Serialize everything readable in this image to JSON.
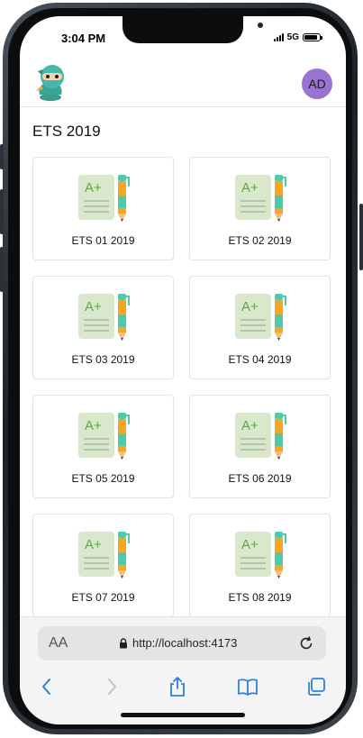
{
  "status": {
    "time": "3:04 PM",
    "network": "5G",
    "battery_level": 0.9
  },
  "header": {
    "avatar_initials": "AD",
    "logo_icon": "ninja-mascot-icon"
  },
  "page": {
    "title": "ETS 2019"
  },
  "tests": [
    {
      "label": "ETS 01 2019"
    },
    {
      "label": "ETS 02 2019"
    },
    {
      "label": "ETS 03 2019"
    },
    {
      "label": "ETS 04 2019"
    },
    {
      "label": "ETS 05 2019"
    },
    {
      "label": "ETS 06 2019"
    },
    {
      "label": "ETS 07 2019"
    },
    {
      "label": "ETS 08 2019"
    }
  ],
  "test_icon": {
    "name": "graded-paper-pencil-icon",
    "grade_text": "A+"
  },
  "browser": {
    "text_size_label": "AA",
    "url": "http://localhost:4173",
    "toolbar": [
      "back-icon",
      "forward-icon",
      "share-icon",
      "bookmarks-icon",
      "tabs-icon"
    ]
  },
  "colors": {
    "accent": "#2f7fd8",
    "avatar": "#9a72d0",
    "paper": "#d9e8cc",
    "grade": "#5aaa3c",
    "pencil": "#f5a623",
    "pencil_band": "#4ecaa8"
  }
}
